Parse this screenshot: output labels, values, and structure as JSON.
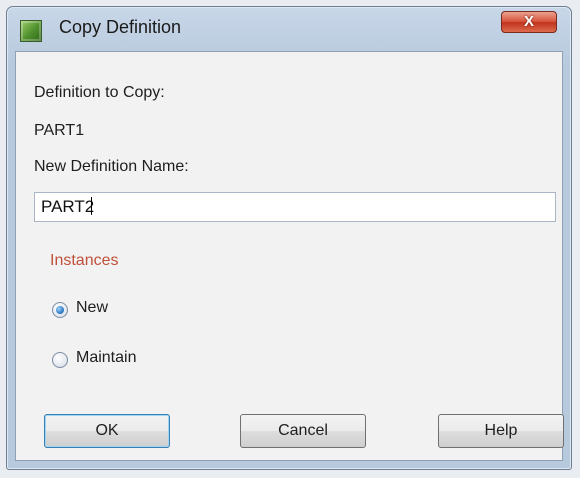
{
  "window": {
    "title": "Copy Definition",
    "close_label": "X"
  },
  "form": {
    "definition_label": "Definition to Copy:",
    "definition_value": "PART1",
    "new_name_label": "New Definition Name:",
    "new_name_value": "PART2"
  },
  "instances": {
    "group_label": "Instances",
    "options": [
      {
        "label": "New",
        "selected": true
      },
      {
        "label": "Maintain",
        "selected": false
      }
    ]
  },
  "buttons": {
    "ok": "OK",
    "cancel": "Cancel",
    "help": "Help"
  },
  "colors": {
    "group_label": "#c0503a",
    "close_button": "#d9533b",
    "default_button_border": "#3c7fb1"
  }
}
